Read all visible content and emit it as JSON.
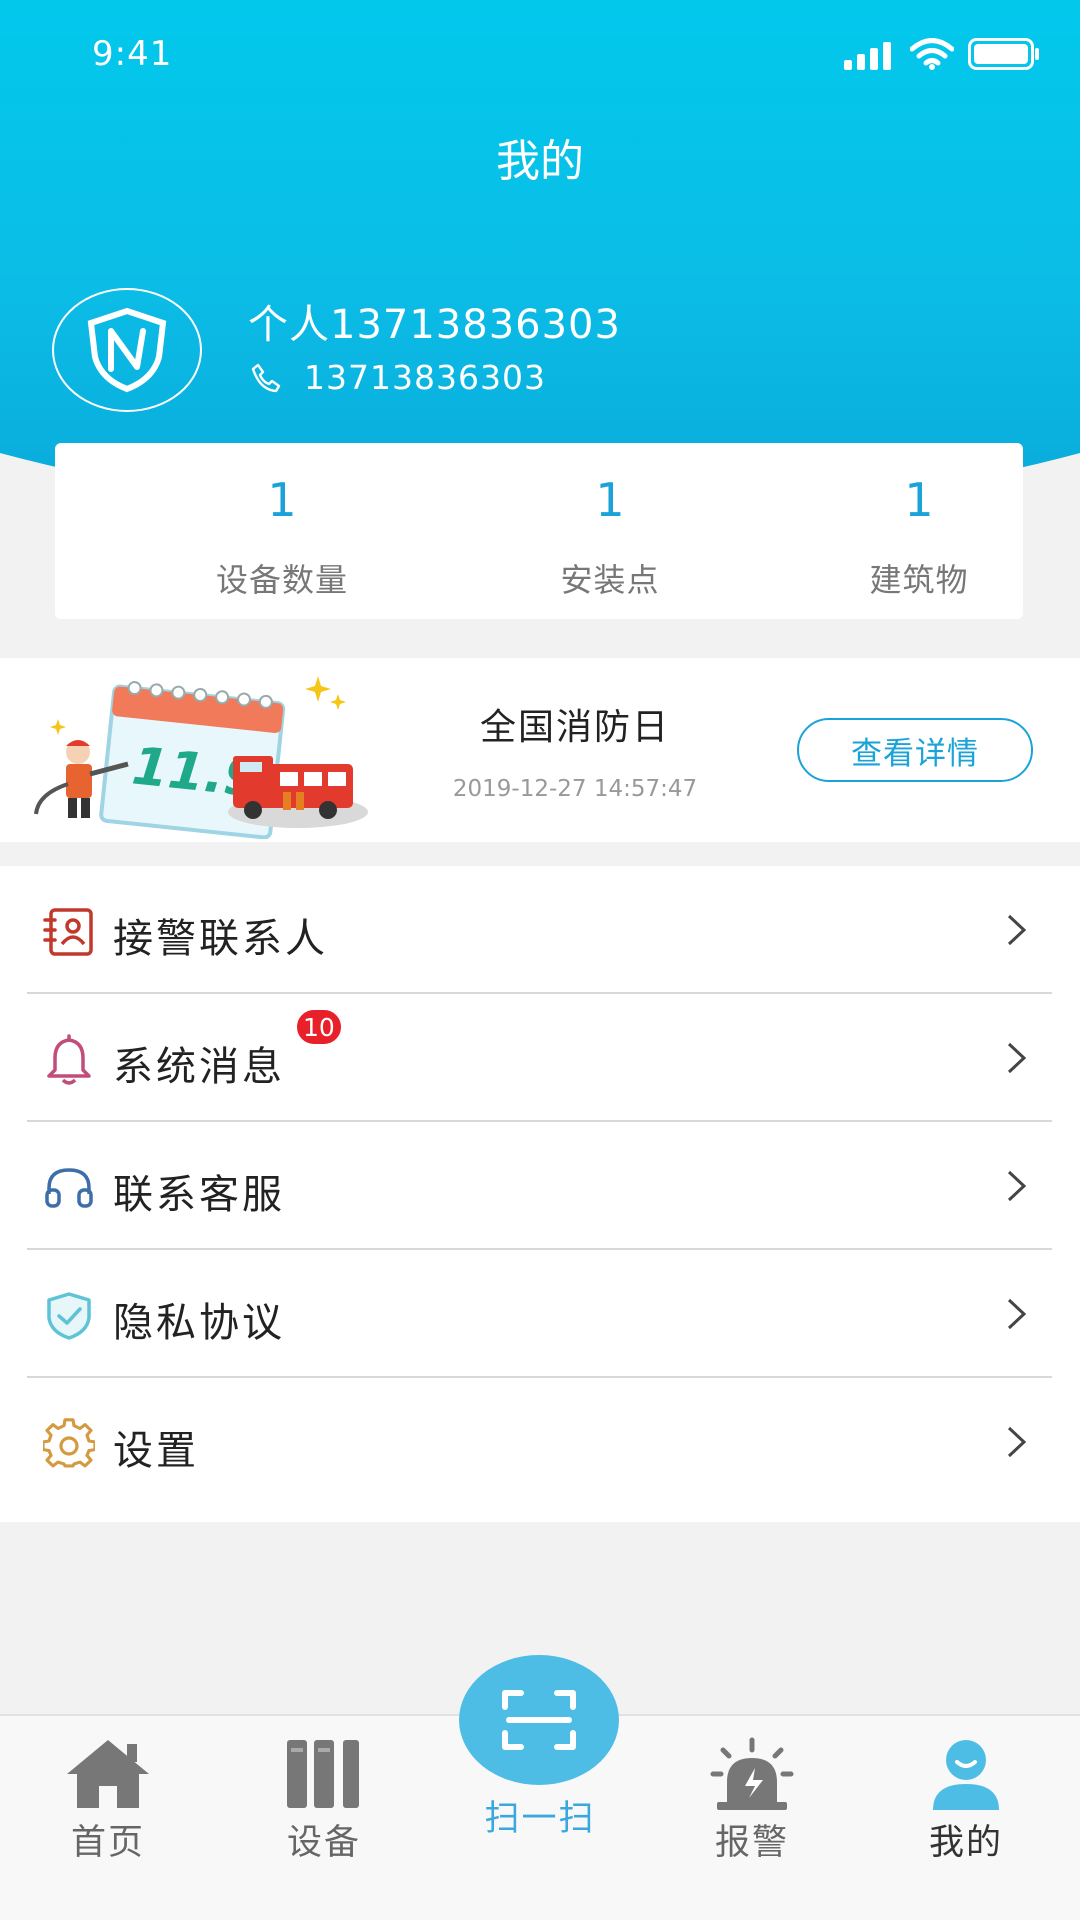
{
  "status_bar": {
    "time": "9:41"
  },
  "header": {
    "title": "我的"
  },
  "profile": {
    "name": "个人13713836303",
    "phone": "13713836303"
  },
  "stats": [
    {
      "value": "1",
      "label": "设备数量"
    },
    {
      "value": "1",
      "label": "安装点"
    },
    {
      "value": "1",
      "label": "建筑物"
    }
  ],
  "banner": {
    "title": "全国消防日",
    "date": "2019-12-27 14:57:47",
    "button_label": "查看详情",
    "calendar_text": "11.9"
  },
  "menu": [
    {
      "label": "接警联系人",
      "icon": "contact-card-icon",
      "color": "#c0392b"
    },
    {
      "label": "系统消息",
      "icon": "bell-icon",
      "color": "#c04d7a",
      "badge": "10"
    },
    {
      "label": "联系客服",
      "icon": "headset-icon",
      "color": "#3d6ea8"
    },
    {
      "label": "隐私协议",
      "icon": "shield-check-icon",
      "color": "#5fc3d6"
    },
    {
      "label": "设置",
      "icon": "gear-icon",
      "color": "#d39a3f"
    }
  ],
  "tabbar": {
    "tabs": [
      {
        "label": "首页",
        "icon": "home-icon"
      },
      {
        "label": "设备",
        "icon": "device-icon"
      },
      {
        "label": "扫一扫",
        "icon": "scan-icon"
      },
      {
        "label": "报警",
        "icon": "alarm-icon"
      },
      {
        "label": "我的",
        "icon": "user-icon"
      }
    ],
    "active": "我的"
  },
  "colors": {
    "accent": "#1aa3d8",
    "header": "#02c8ec",
    "badge": "#e8202a",
    "scan": "#4dbde6"
  }
}
